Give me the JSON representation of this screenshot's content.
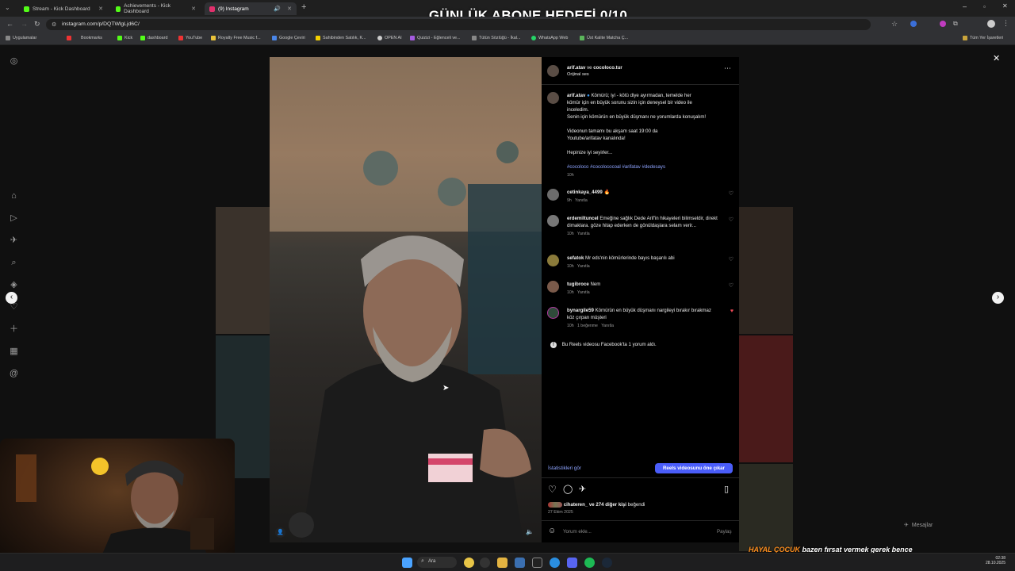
{
  "overlay": {
    "title": "GÜNLÜK ABONE HEDEFİ 0/10"
  },
  "browser": {
    "tabs": [
      {
        "label": "Stream - Kick Dashboard",
        "color": "#53fc18"
      },
      {
        "label": "Achievements - Kick Dashboard",
        "color": "#53fc18"
      },
      {
        "label": "(9) Instagram",
        "color": "#e1306c"
      }
    ],
    "url": "instagram.com/p/DQTWlgLjd6C/",
    "bookmarks": [
      "Uygulamalar",
      "Bookmarks",
      "Kick",
      "dashboard",
      "YouTube",
      "Royalty Free Music f...",
      "Google Çeviri",
      "Sahibinden Satılık, K...",
      "OPEN AI",
      "Quizizi - Eğlenceli ve...",
      "Tütün Sözlüğü - İkal...",
      "WhatsApp Web",
      "Üst Kalite Matcha Ç...",
      "Tüm Yer İşaretleri"
    ]
  },
  "post": {
    "header_user": "arif.atav",
    "header_and": "ve",
    "header_coauthor": "cocoloco.tur",
    "audio": "Orijinal ses",
    "caption_user": "arif.atav",
    "caption_lines": [
      "Kömürü; iyi - kötü diye ayırmadan, temelde her",
      "kömür için en büyük sorunu sizin için deneysel bir video ile",
      "inceledim.",
      "Senin için kömürün en büyük düşmanı ne yorumlarda konuşalım!"
    ],
    "caption_p2": [
      "Videonun tamamı bu akşam saat 19:00 da",
      "Youtube/arifatav kanalında!"
    ],
    "caption_p3": "Hepinize iyi seyirler...",
    "hashtags": "#cocoloco #cocolococoal #arifatav #dedesays",
    "caption_time": "10h",
    "location_hint": "İstanbul - Türkiye",
    "comments": [
      {
        "user": "cetinkaya_4499",
        "text": "🔥",
        "time": "9h",
        "reply": "Yanıtla"
      },
      {
        "user": "erdemiltuncel",
        "text": "Emeğine sağlık Dede Arif'in hikayeleri bilimseldir, direkt dimaklara. göze hitap ederken de gönüldaşlara selam verir...",
        "time": "10h",
        "reply": "Yanıtla"
      },
      {
        "user": "sefatok",
        "text": "Mr eds'nin kömürlerinde bayıs başarılı abi",
        "time": "10h",
        "reply": "Yanıtla"
      },
      {
        "user": "tugibroce",
        "text": "Nem",
        "time": "10h",
        "reply": "Yanıtla"
      },
      {
        "user": "bynargile59",
        "text": "Kömürün en büyük düşmanı nargileyi bırakır bırakmaz köz çırpan müşteri",
        "time": "10h",
        "likes": "1 beğenme",
        "reply": "Yanıtla"
      }
    ],
    "facebook_note": "Bu Reels videosu Facebook'ta 1 yorum aldı.",
    "insights_link": "İstatistikleri gör",
    "boost_button": "Reels videosunu öne çıkar",
    "likes_user": "cihateren_",
    "likes_rest": "ve 274 diğer kişi",
    "likes_suffix": "beğendi",
    "date": "27 Ekim 2025",
    "comment_placeholder": "Yorum ekle...",
    "share_label": "Paylaş"
  },
  "page": {
    "messages_label": "Mesajlar"
  },
  "stream": {
    "ticker_brand": "HAYAL ÇOCUK",
    "ticker_text": "bazen fırsat vermek gerek bence"
  },
  "taskbar": {
    "search_label": "Ara",
    "time": "02:38",
    "date": "28.10.2025"
  }
}
